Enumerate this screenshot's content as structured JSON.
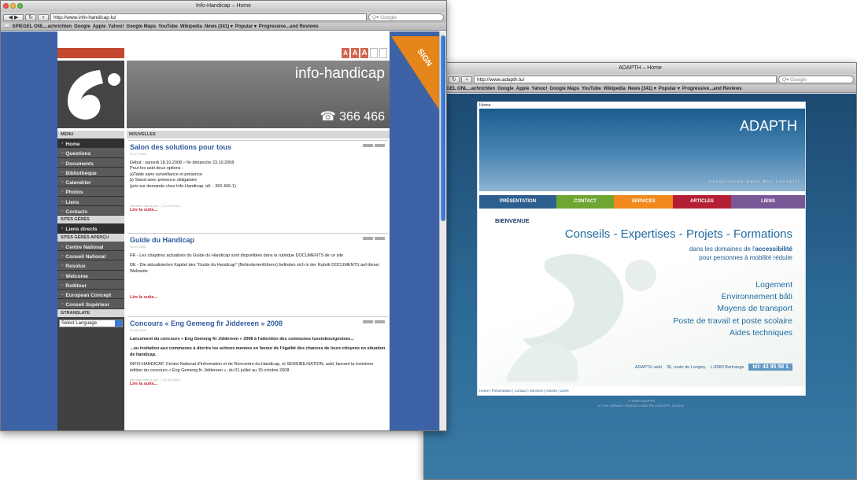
{
  "window1": {
    "title": "Info-Handicap – Home",
    "url": "http://www.info-handicap.lu/",
    "search_placeholder": "Q▾ Google",
    "bookmarks": [
      "SPIEGEL ONL...achrichten",
      "Google",
      "Apple",
      "Yahoo!",
      "Google Maps",
      "YouTube",
      "Wikipedia",
      "News (341) ▾",
      "Popular ▾",
      "Progressive...and Reviews"
    ],
    "site": {
      "brand": "info-handicap",
      "phone": "☎ 366 466",
      "font_sizes": [
        "A",
        "A",
        "A"
      ],
      "menu_header": "MENU",
      "menu": [
        "Home",
        "Questions",
        "Documents",
        "Bibliothèque",
        "Calendrier",
        "Photos",
        "Liens",
        "Contacts"
      ],
      "managed_header": "SITES GÉRÉS",
      "managed": [
        "Liens directs"
      ],
      "preview_header": "SITES GÉRÉS APERÇU",
      "preview": [
        "Centre National",
        "Conseil National",
        "Resolux",
        "Welcome",
        "Rollitour",
        "European Concept",
        "Conseil Supérieur"
      ],
      "translate_header": "GTRANSLATE",
      "language": "Select Language",
      "news_header": "NOUVELLES",
      "sticker": "SIGN",
      "articles": [
        {
          "title": "Salon des solutions pour tous",
          "date": "07-07-2008",
          "body": [
            "Début : samedi 18.10.2008 – fin dimanche 23.10.2008",
            "Pour les asbl deux options :",
            "a)Table sans surveillance et présence",
            "b) Stand avec présence obligatoire",
            "(prix sur demande chez Info-Handicap, tél. : 366 466-1)"
          ],
          "updated": "Dernière mise à jour : ( 11-09-2008 )",
          "more": "Lire la suite..."
        },
        {
          "title": "Guide du Handicap",
          "date": "04-07-2008",
          "body": [
            "FR - Les chapitres actualisés du Guide du Handicap sont disponibles dans la rubrique DOCUMENTS de ce site",
            "DE - Die aktualisierten Kapitel des \"Guide du Handicap\" (Behindertenführers) befinden sich in der Rubrik DOCUMENTS auf dieser Webseite"
          ],
          "updated": "",
          "more": "Lire la suite..."
        },
        {
          "title": "Concours « Eng Gemeng fir Jiddereen » 2008",
          "date": "30-06-2008",
          "body": [
            "Lancement du concours « Eng Gemeng fir Jiddereen » 2008 à l'attention des communes luxembourgeoises...",
            "...ou invitation aux communes à décrire les actions menées en faveur de l'égalité des chances de leurs citoyens en situation de handicap.",
            "INFO-HANDICAP, Centre National d'Information et de Rencontre du Handicap, et SENSIBILISATION, asbl, lancent la troisième  édition du concours « Eng Gemeng fir Jiddereen », du 01 juillet au 15 octobre 2008."
          ],
          "updated": "Dernière mise à jour : ( 30-06-2008 )",
          "more": "Lire la suite..."
        }
      ]
    }
  },
  "window2": {
    "title": "ADAPTH – Home",
    "url": "http://www.adapth.lu/",
    "search_placeholder": "Q▾ Google",
    "bookmarks": [
      "SPIEGEL ONL...achrichten",
      "Google",
      "Apple",
      "Yahoo!",
      "Google Maps",
      "YouTube",
      "Wikipedia",
      "News (341) ▾",
      "Popular ▾",
      "Progressive...and Reviews"
    ],
    "site": {
      "home_link": "Home",
      "brand": "ADAPTH",
      "subtitle": "Association Sans But Lucratif",
      "nav": [
        {
          "label": "PRÉSENTATION",
          "color": "#2d5f8e"
        },
        {
          "label": "CONTACT",
          "color": "#6fa531"
        },
        {
          "label": "SERVICES",
          "color": "#f08a1c"
        },
        {
          "label": "ARTICLES",
          "color": "#b51f34"
        },
        {
          "label": "LIENS",
          "color": "#7a5896"
        }
      ],
      "welcome": "BIENVENUE",
      "headline": "Conseils - Expertises - Projets - Formations",
      "domains_line1_prefix": "dans les domaines de l'",
      "domains_line1_bold": "accessibilité",
      "domains_line2": "pour personnes à mobilité réduite",
      "topics": [
        "Logement",
        "Environnement bâti",
        "Moyens de transport",
        "Poste de travail et poste scolaire",
        "Aides techniques"
      ],
      "address_name": "ADAPTH asbl",
      "address_street": "36, route de Longwy",
      "address_city": "L-8080 Bertrange",
      "phone": "tél: 43 95 58 1",
      "footer_links": "Home | Présentation | Contact | Services | Articles | Liens",
      "copyright": "© 2008 ADAPTH",
      "license": "is Free Software released under the GNU/GPL License."
    }
  }
}
